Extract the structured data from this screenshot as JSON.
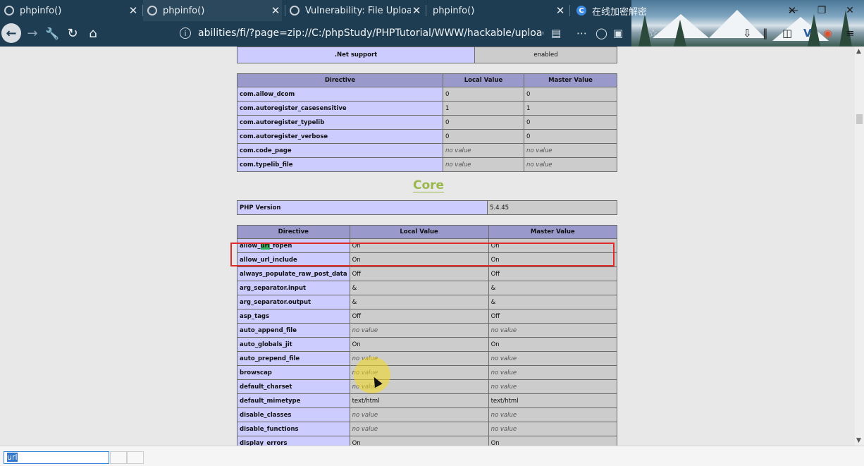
{
  "browser": {
    "tabs": [
      {
        "title": "phpinfo()",
        "close": "✕",
        "favicon": "phpinfo-favicon-icon"
      },
      {
        "title": "phpinfo()",
        "close": "✕",
        "favicon": "phpinfo-favicon-icon"
      },
      {
        "title": "Vulnerability: File Upload :: [",
        "close": "✕",
        "favicon": "dvwa-favicon-icon"
      },
      {
        "title": "phpinfo()",
        "close": "✕",
        "favicon": "none"
      },
      {
        "title": "在线加密解密",
        "close": "✕",
        "favicon": "c-favicon-icon"
      }
    ],
    "address": "abilities/fi/?page=zip://C:/phpStudy/PHPTutorial/WWW/hackable/uploads/php",
    "window_controls": {
      "minimize": "—",
      "restore": "❐",
      "close": "✕"
    }
  },
  "net_table": {
    "label": ".Net support",
    "value": "enabled"
  },
  "com_table": {
    "headers": [
      "Directive",
      "Local Value",
      "Master Value"
    ],
    "rows": [
      [
        "com.allow_dcom",
        "0",
        "0"
      ],
      [
        "com.autoregister_casesensitive",
        "1",
        "1"
      ],
      [
        "com.autoregister_typelib",
        "0",
        "0"
      ],
      [
        "com.autoregister_verbose",
        "0",
        "0"
      ],
      [
        "com.code_page",
        "no value",
        "no value"
      ],
      [
        "com.typelib_file",
        "no value",
        "no value"
      ]
    ]
  },
  "core_section": {
    "title": "Core",
    "php_version_label": "PHP Version",
    "php_version_value": "5.4.45"
  },
  "core_table": {
    "headers": [
      "Directive",
      "Local Value",
      "Master Value"
    ],
    "rows": [
      [
        "allow_url_fopen",
        "On",
        "On"
      ],
      [
        "allow_url_include",
        "On",
        "On"
      ],
      [
        "always_populate_raw_post_data",
        "Off",
        "Off"
      ],
      [
        "arg_separator.input",
        "&",
        "&"
      ],
      [
        "arg_separator.output",
        "&",
        "&"
      ],
      [
        "asp_tags",
        "Off",
        "Off"
      ],
      [
        "auto_append_file",
        "no value",
        "no value"
      ],
      [
        "auto_globals_jit",
        "On",
        "On"
      ],
      [
        "auto_prepend_file",
        "no value",
        "no value"
      ],
      [
        "browscap",
        "no value",
        "no value"
      ],
      [
        "default_charset",
        "no value",
        "no value"
      ],
      [
        "default_mimetype",
        "text/html",
        "text/html"
      ],
      [
        "disable_classes",
        "no value",
        "no value"
      ],
      [
        "disable_functions",
        "no value",
        "no value"
      ],
      [
        "display_errors",
        "On",
        "On"
      ]
    ],
    "highlighted_rows": [
      "allow_url_fopen",
      "allow_url_include"
    ],
    "highlight_color": "#e02b2b"
  },
  "find_bar": {
    "query": "url"
  }
}
